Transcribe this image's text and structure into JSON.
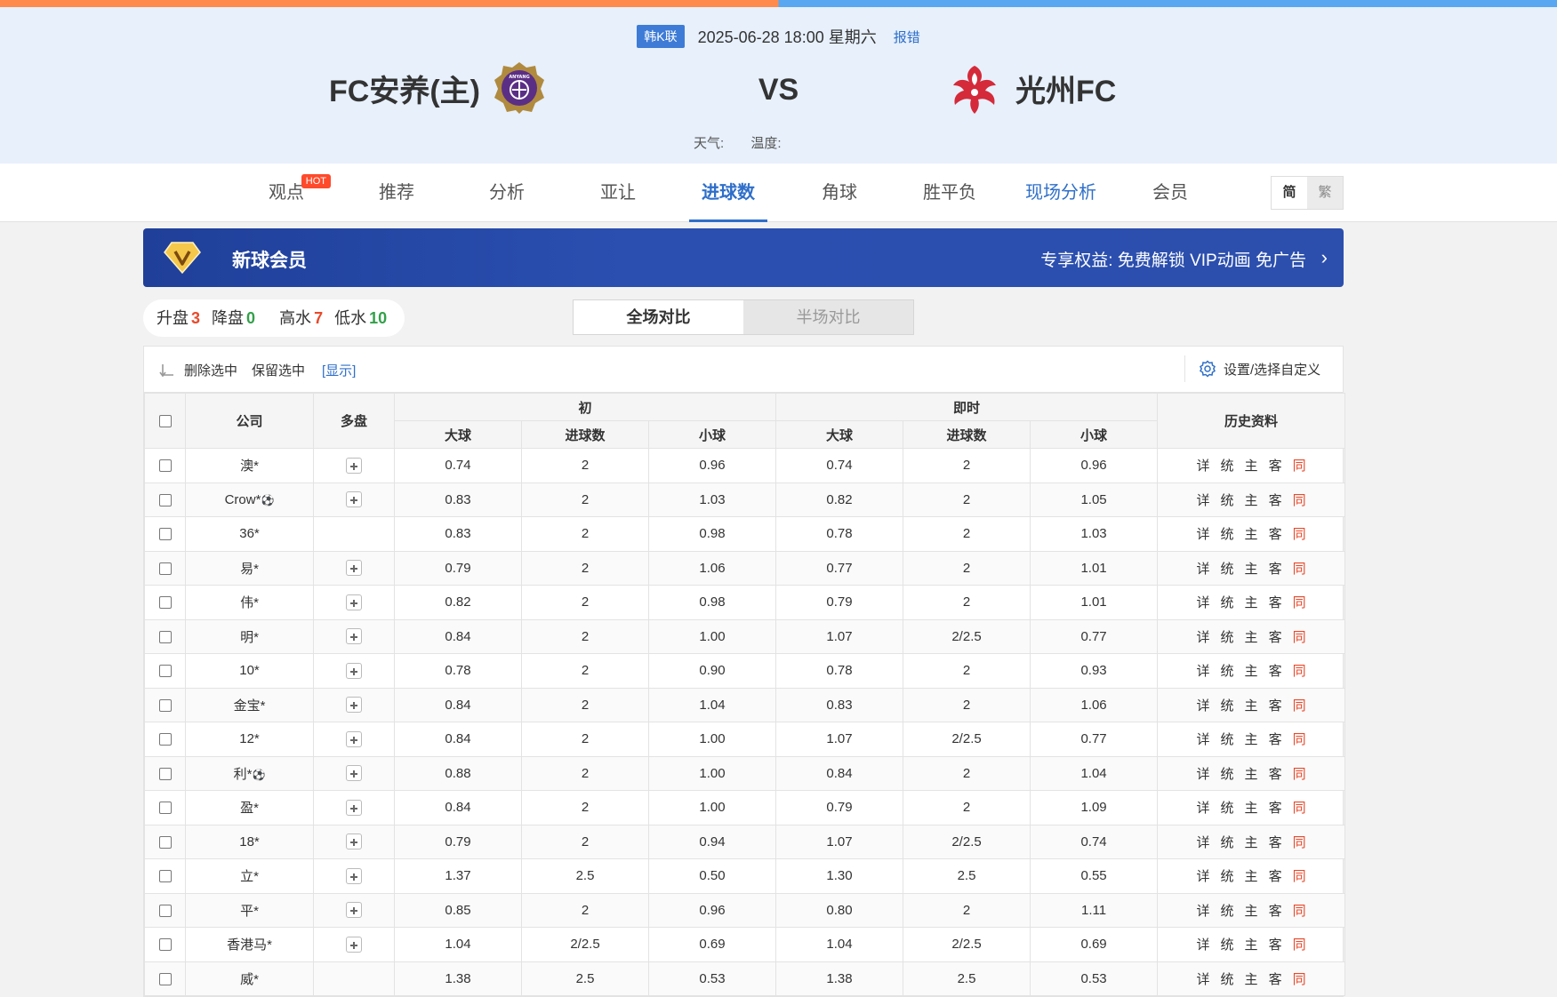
{
  "header": {
    "league": "韩K联",
    "datetime": "2025-06-28 18:00 星期六",
    "report_error": "报错",
    "home_team": "FC安养(主)",
    "away_team": "光州FC",
    "vs": "VS",
    "weather_label": "天气:",
    "temperature_label": "温度:"
  },
  "nav": {
    "items": [
      {
        "label": "观点"
      },
      {
        "label": "推荐"
      },
      {
        "label": "分析"
      },
      {
        "label": "亚让"
      },
      {
        "label": "进球数"
      },
      {
        "label": "角球"
      },
      {
        "label": "胜平负"
      },
      {
        "label": "现场分析"
      },
      {
        "label": "会员"
      }
    ],
    "hot_badge": "HOT",
    "lang_simplified": "简",
    "lang_traditional": "繁"
  },
  "vip": {
    "title": "新球会员",
    "perk": "专享权益: 免费解锁 VIP动画 免广告",
    "chevron": "›"
  },
  "stats": {
    "up_label": "升盘",
    "up": "3",
    "down_label": "降盘",
    "down": "0",
    "high_label": "高水",
    "high": "7",
    "low_label": "低水",
    "low": "10"
  },
  "compare": {
    "full": "全场对比",
    "half": "半场对比"
  },
  "toolbar": {
    "delete_selected": "删除选中",
    "keep_selected": "保留选中",
    "show": "[显示]",
    "settings": "设置/选择自定义"
  },
  "table": {
    "h_company": "公司",
    "h_multi": "多盘",
    "h_initial": "初",
    "h_live": "即时",
    "h_history": "历史资料",
    "h_big": "大球",
    "h_goals": "进球数",
    "h_small": "小球",
    "hist_links": {
      "detail": "详",
      "stats": "统",
      "home": "主",
      "away": "客",
      "same": "同"
    },
    "rows": [
      {
        "company": "澳*",
        "ball": "",
        "multi": true,
        "i_big": "0.74",
        "i_goals": "2",
        "i_small": "0.96",
        "l_big": "0.74",
        "l_goals": "2",
        "l_small": "0.96"
      },
      {
        "company": "Crow*",
        "ball": "⚽",
        "multi": true,
        "i_big": "0.83",
        "i_goals": "2",
        "i_small": "1.03",
        "l_big": "0.82",
        "l_goals": "2",
        "l_small": "1.05"
      },
      {
        "company": "36*",
        "ball": "",
        "multi": false,
        "i_big": "0.83",
        "i_goals": "2",
        "i_small": "0.98",
        "l_big": "0.78",
        "l_goals": "2",
        "l_small": "1.03"
      },
      {
        "company": "易*",
        "ball": "",
        "multi": true,
        "i_big": "0.79",
        "i_goals": "2",
        "i_small": "1.06",
        "l_big": "0.77",
        "l_goals": "2",
        "l_small": "1.01"
      },
      {
        "company": "伟*",
        "ball": "",
        "multi": true,
        "i_big": "0.82",
        "i_goals": "2",
        "i_small": "0.98",
        "l_big": "0.79",
        "l_goals": "2",
        "l_small": "1.01"
      },
      {
        "company": "明*",
        "ball": "",
        "multi": true,
        "i_big": "0.84",
        "i_goals": "2",
        "i_small": "1.00",
        "l_big": "1.07",
        "l_goals": "2/2.5",
        "l_small": "0.77"
      },
      {
        "company": "10*",
        "ball": "",
        "multi": true,
        "i_big": "0.78",
        "i_goals": "2",
        "i_small": "0.90",
        "l_big": "0.78",
        "l_goals": "2",
        "l_small": "0.93"
      },
      {
        "company": "金宝*",
        "ball": "",
        "multi": true,
        "i_big": "0.84",
        "i_goals": "2",
        "i_small": "1.04",
        "l_big": "0.83",
        "l_goals": "2",
        "l_small": "1.06"
      },
      {
        "company": "12*",
        "ball": "",
        "multi": true,
        "i_big": "0.84",
        "i_goals": "2",
        "i_small": "1.00",
        "l_big": "1.07",
        "l_goals": "2/2.5",
        "l_small": "0.77"
      },
      {
        "company": "利*",
        "ball": "⚽",
        "multi": true,
        "i_big": "0.88",
        "i_goals": "2",
        "i_small": "1.00",
        "l_big": "0.84",
        "l_goals": "2",
        "l_small": "1.04"
      },
      {
        "company": "盈*",
        "ball": "",
        "multi": true,
        "i_big": "0.84",
        "i_goals": "2",
        "i_small": "1.00",
        "l_big": "0.79",
        "l_goals": "2",
        "l_small": "1.09"
      },
      {
        "company": "18*",
        "ball": "",
        "multi": true,
        "i_big": "0.79",
        "i_goals": "2",
        "i_small": "0.94",
        "l_big": "1.07",
        "l_goals": "2/2.5",
        "l_small": "0.74"
      },
      {
        "company": "立*",
        "ball": "",
        "multi": true,
        "i_big": "1.37",
        "i_goals": "2.5",
        "i_small": "0.50",
        "l_big": "1.30",
        "l_goals": "2.5",
        "l_small": "0.55"
      },
      {
        "company": "平*",
        "ball": "",
        "multi": true,
        "i_big": "0.85",
        "i_goals": "2",
        "i_small": "0.96",
        "l_big": "0.80",
        "l_goals": "2",
        "l_small": "1.11"
      },
      {
        "company": "香港马*",
        "ball": "",
        "multi": true,
        "i_big": "1.04",
        "i_goals": "2/2.5",
        "i_small": "0.69",
        "l_big": "1.04",
        "l_goals": "2/2.5",
        "l_small": "0.69"
      },
      {
        "company": "威*",
        "ball": "",
        "multi": false,
        "i_big": "1.38",
        "i_goals": "2.5",
        "i_small": "0.53",
        "l_big": "1.38",
        "l_goals": "2.5",
        "l_small": "0.53"
      }
    ]
  }
}
